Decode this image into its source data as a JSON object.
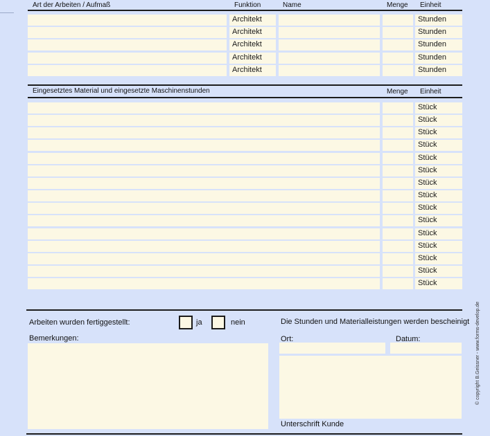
{
  "section1": {
    "headers": {
      "art": "Art der Arbeiten / Aufmaß",
      "funktion": "Funktion",
      "name": "Name",
      "menge": "Menge",
      "einheit": "Einheit"
    },
    "rows": [
      {
        "art": "",
        "funktion": "Architekt",
        "name": "",
        "menge": "",
        "einheit": "Stunden"
      },
      {
        "art": "",
        "funktion": "Architekt",
        "name": "",
        "menge": "",
        "einheit": "Stunden"
      },
      {
        "art": "",
        "funktion": "Architekt",
        "name": "",
        "menge": "",
        "einheit": "Stunden"
      },
      {
        "art": "",
        "funktion": "Architekt",
        "name": "",
        "menge": "",
        "einheit": "Stunden"
      },
      {
        "art": "",
        "funktion": "Architekt",
        "name": "",
        "menge": "",
        "einheit": "Stunden"
      }
    ]
  },
  "section2": {
    "headers": {
      "material": "Eingesetztes Material und eingesetzte Maschinenstunden",
      "menge": "Menge",
      "einheit": "Einheit"
    },
    "rows": [
      {
        "material": "",
        "menge": "",
        "einheit": "Stück"
      },
      {
        "material": "",
        "menge": "",
        "einheit": "Stück"
      },
      {
        "material": "",
        "menge": "",
        "einheit": "Stück"
      },
      {
        "material": "",
        "menge": "",
        "einheit": "Stück"
      },
      {
        "material": "",
        "menge": "",
        "einheit": "Stück"
      },
      {
        "material": "",
        "menge": "",
        "einheit": "Stück"
      },
      {
        "material": "",
        "menge": "",
        "einheit": "Stück"
      },
      {
        "material": "",
        "menge": "",
        "einheit": "Stück"
      },
      {
        "material": "",
        "menge": "",
        "einheit": "Stück"
      },
      {
        "material": "",
        "menge": "",
        "einheit": "Stück"
      },
      {
        "material": "",
        "menge": "",
        "einheit": "Stück"
      },
      {
        "material": "",
        "menge": "",
        "einheit": "Stück"
      },
      {
        "material": "",
        "menge": "",
        "einheit": "Stück"
      },
      {
        "material": "",
        "menge": "",
        "einheit": "Stück"
      },
      {
        "material": "",
        "menge": "",
        "einheit": "Stück"
      }
    ]
  },
  "footer": {
    "completed_label": "Arbeiten wurden fertiggestellt:",
    "yes_label": "ja",
    "no_label": "nein",
    "remarks_label": "Bemerkungen:",
    "remarks_value": "",
    "confirm_label": "Die Stunden und Materialleistungen werden bescheinigt",
    "ort_label": "Ort:",
    "ort_value": "",
    "datum_label": "Datum:",
    "datum_value": "",
    "signature_value": "",
    "signature_label": "Unterschrift Kunde",
    "copyright": "© copyright B.Geissner - www.forms-develop.de"
  }
}
